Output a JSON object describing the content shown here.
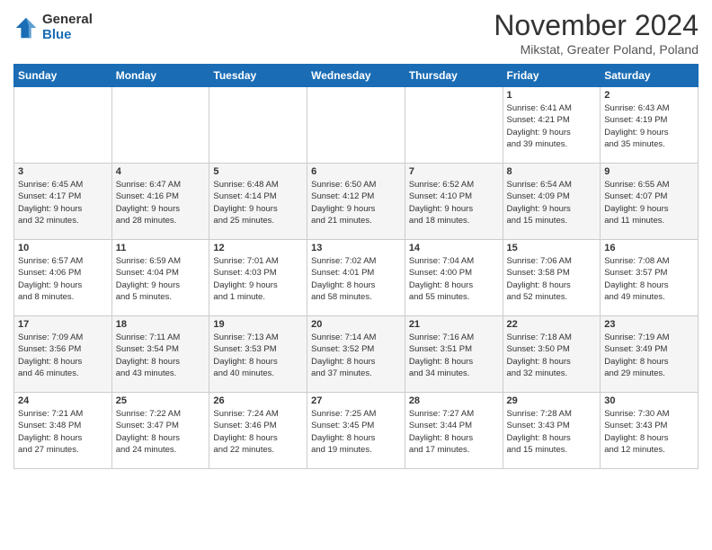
{
  "logo": {
    "general": "General",
    "blue": "Blue"
  },
  "title": "November 2024",
  "location": "Mikstat, Greater Poland, Poland",
  "days_of_week": [
    "Sunday",
    "Monday",
    "Tuesday",
    "Wednesday",
    "Thursday",
    "Friday",
    "Saturday"
  ],
  "weeks": [
    [
      {
        "day": "",
        "info": ""
      },
      {
        "day": "",
        "info": ""
      },
      {
        "day": "",
        "info": ""
      },
      {
        "day": "",
        "info": ""
      },
      {
        "day": "",
        "info": ""
      },
      {
        "day": "1",
        "info": "Sunrise: 6:41 AM\nSunset: 4:21 PM\nDaylight: 9 hours\nand 39 minutes."
      },
      {
        "day": "2",
        "info": "Sunrise: 6:43 AM\nSunset: 4:19 PM\nDaylight: 9 hours\nand 35 minutes."
      }
    ],
    [
      {
        "day": "3",
        "info": "Sunrise: 6:45 AM\nSunset: 4:17 PM\nDaylight: 9 hours\nand 32 minutes."
      },
      {
        "day": "4",
        "info": "Sunrise: 6:47 AM\nSunset: 4:16 PM\nDaylight: 9 hours\nand 28 minutes."
      },
      {
        "day": "5",
        "info": "Sunrise: 6:48 AM\nSunset: 4:14 PM\nDaylight: 9 hours\nand 25 minutes."
      },
      {
        "day": "6",
        "info": "Sunrise: 6:50 AM\nSunset: 4:12 PM\nDaylight: 9 hours\nand 21 minutes."
      },
      {
        "day": "7",
        "info": "Sunrise: 6:52 AM\nSunset: 4:10 PM\nDaylight: 9 hours\nand 18 minutes."
      },
      {
        "day": "8",
        "info": "Sunrise: 6:54 AM\nSunset: 4:09 PM\nDaylight: 9 hours\nand 15 minutes."
      },
      {
        "day": "9",
        "info": "Sunrise: 6:55 AM\nSunset: 4:07 PM\nDaylight: 9 hours\nand 11 minutes."
      }
    ],
    [
      {
        "day": "10",
        "info": "Sunrise: 6:57 AM\nSunset: 4:06 PM\nDaylight: 9 hours\nand 8 minutes."
      },
      {
        "day": "11",
        "info": "Sunrise: 6:59 AM\nSunset: 4:04 PM\nDaylight: 9 hours\nand 5 minutes."
      },
      {
        "day": "12",
        "info": "Sunrise: 7:01 AM\nSunset: 4:03 PM\nDaylight: 9 hours\nand 1 minute."
      },
      {
        "day": "13",
        "info": "Sunrise: 7:02 AM\nSunset: 4:01 PM\nDaylight: 8 hours\nand 58 minutes."
      },
      {
        "day": "14",
        "info": "Sunrise: 7:04 AM\nSunset: 4:00 PM\nDaylight: 8 hours\nand 55 minutes."
      },
      {
        "day": "15",
        "info": "Sunrise: 7:06 AM\nSunset: 3:58 PM\nDaylight: 8 hours\nand 52 minutes."
      },
      {
        "day": "16",
        "info": "Sunrise: 7:08 AM\nSunset: 3:57 PM\nDaylight: 8 hours\nand 49 minutes."
      }
    ],
    [
      {
        "day": "17",
        "info": "Sunrise: 7:09 AM\nSunset: 3:56 PM\nDaylight: 8 hours\nand 46 minutes."
      },
      {
        "day": "18",
        "info": "Sunrise: 7:11 AM\nSunset: 3:54 PM\nDaylight: 8 hours\nand 43 minutes."
      },
      {
        "day": "19",
        "info": "Sunrise: 7:13 AM\nSunset: 3:53 PM\nDaylight: 8 hours\nand 40 minutes."
      },
      {
        "day": "20",
        "info": "Sunrise: 7:14 AM\nSunset: 3:52 PM\nDaylight: 8 hours\nand 37 minutes."
      },
      {
        "day": "21",
        "info": "Sunrise: 7:16 AM\nSunset: 3:51 PM\nDaylight: 8 hours\nand 34 minutes."
      },
      {
        "day": "22",
        "info": "Sunrise: 7:18 AM\nSunset: 3:50 PM\nDaylight: 8 hours\nand 32 minutes."
      },
      {
        "day": "23",
        "info": "Sunrise: 7:19 AM\nSunset: 3:49 PM\nDaylight: 8 hours\nand 29 minutes."
      }
    ],
    [
      {
        "day": "24",
        "info": "Sunrise: 7:21 AM\nSunset: 3:48 PM\nDaylight: 8 hours\nand 27 minutes."
      },
      {
        "day": "25",
        "info": "Sunrise: 7:22 AM\nSunset: 3:47 PM\nDaylight: 8 hours\nand 24 minutes."
      },
      {
        "day": "26",
        "info": "Sunrise: 7:24 AM\nSunset: 3:46 PM\nDaylight: 8 hours\nand 22 minutes."
      },
      {
        "day": "27",
        "info": "Sunrise: 7:25 AM\nSunset: 3:45 PM\nDaylight: 8 hours\nand 19 minutes."
      },
      {
        "day": "28",
        "info": "Sunrise: 7:27 AM\nSunset: 3:44 PM\nDaylight: 8 hours\nand 17 minutes."
      },
      {
        "day": "29",
        "info": "Sunrise: 7:28 AM\nSunset: 3:43 PM\nDaylight: 8 hours\nand 15 minutes."
      },
      {
        "day": "30",
        "info": "Sunrise: 7:30 AM\nSunset: 3:43 PM\nDaylight: 8 hours\nand 12 minutes."
      }
    ]
  ]
}
